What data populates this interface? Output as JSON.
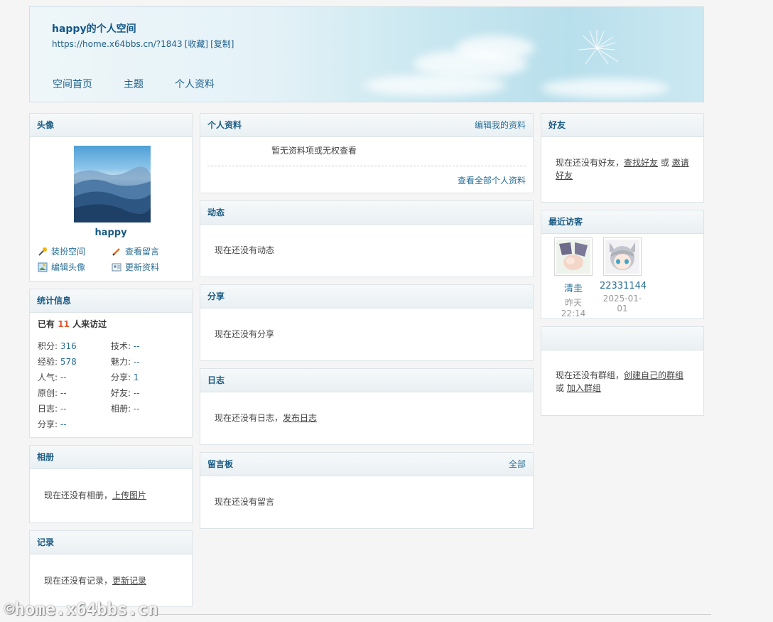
{
  "header": {
    "title": "happy的个人空间",
    "url": "https://home.x64bbs.cn/?1843",
    "favorite": "[收藏]",
    "copy": "[复制]",
    "nav": [
      "空间首页",
      "主题",
      "个人资料"
    ]
  },
  "avatar_panel": {
    "title": "头像",
    "username": "happy",
    "actions": [
      "装扮空间",
      "查看留言",
      "编辑头像",
      "更新资料"
    ]
  },
  "stats_panel": {
    "title": "统计信息",
    "visits_prefix": "已有",
    "visits_count": "11",
    "visits_suffix": "人来访过",
    "items": [
      {
        "label": "积分: ",
        "value": "316"
      },
      {
        "label": "技术: ",
        "value": "--"
      },
      {
        "label": "经验: ",
        "value": "578"
      },
      {
        "label": "魅力: ",
        "value": "--"
      },
      {
        "label": "人气: ",
        "value": "--"
      },
      {
        "label": "分享: ",
        "value": "1"
      },
      {
        "label": "原创: ",
        "value": "--"
      },
      {
        "label": "好友: ",
        "value": "--"
      },
      {
        "label": "日志: ",
        "value": "--"
      },
      {
        "label": "相册: ",
        "value": "--"
      },
      {
        "label": "分享: ",
        "value": "--"
      }
    ]
  },
  "album_panel": {
    "title": "相册",
    "text": "现在还没有相册，",
    "link": "上传图片"
  },
  "record_panel": {
    "title": "记录",
    "text": "现在还没有记录，",
    "link": "更新记录"
  },
  "profile_panel": {
    "title": "个人资料",
    "right": "编辑我的资料",
    "text": "暂无资料项或无权查看",
    "more": "查看全部个人资料"
  },
  "feed_panel": {
    "title": "动态",
    "text": "现在还没有动态"
  },
  "share_panel": {
    "title": "分享",
    "text": "现在还没有分享"
  },
  "blog_panel": {
    "title": "日志",
    "text": "现在还没有日志，",
    "link": "发布日志"
  },
  "guestbook_panel": {
    "title": "留言板",
    "right": "全部",
    "text": "现在还没有留言"
  },
  "friends_panel": {
    "title": "好友",
    "text": "现在还没有好友，",
    "link1": "查找好友",
    "or": " 或 ",
    "link2a": "邀请",
    "link2b": "好友"
  },
  "visitors_panel": {
    "title": "最近访客",
    "visitors": [
      {
        "name": "清圭",
        "time": "昨天 22:14"
      },
      {
        "name": "22331144",
        "time": "2025-01-01"
      }
    ]
  },
  "group_panel": {
    "title": "",
    "text": "现在还没有群组，",
    "link1": "创建自己的群组",
    "or": "或 ",
    "link2": "加入群组"
  },
  "watermark": "©home.x64bbs.cn"
}
